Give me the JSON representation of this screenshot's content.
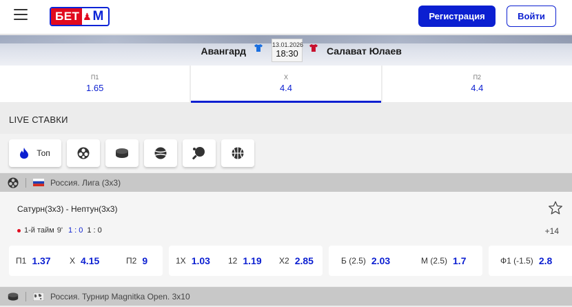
{
  "header": {
    "logo_text_bet": "БЕТ",
    "logo_text_m": "М",
    "register_label": "Регистрация",
    "login_label": "Войти"
  },
  "match": {
    "home_team": "Авангард",
    "away_team": "Салават Юлаев",
    "date": "13.01.2026",
    "time": "18:30",
    "home_shirt_color": "#1a6fe0",
    "away_shirt_color": "#c8102e"
  },
  "main_odds": [
    {
      "label": "П1",
      "value": "1.65"
    },
    {
      "label": "Х",
      "value": "4.4"
    },
    {
      "label": "П2",
      "value": "4.4"
    }
  ],
  "live": {
    "title": "LIVE СТАВКИ",
    "top_tab_label": "Топ",
    "sport_icons": [
      "fire-icon",
      "volleyball-icon",
      "hockey-puck-icon",
      "tennis-ball-icon",
      "table-tennis-icon",
      "basketball-icon"
    ]
  },
  "league1": {
    "name": "Россия. Лига (3х3)",
    "flag": "russia-flag"
  },
  "event": {
    "teams": "Сатурн(3х3) - Нептун(3х3)",
    "period": "1-й тайм",
    "minute": "9'",
    "score_main": "1 : 0",
    "score_period": "1 : 0",
    "more_bets": "+14",
    "bets": [
      {
        "label": "П1",
        "value": "1.37"
      },
      {
        "label": "Х",
        "value": "4.15"
      },
      {
        "label": "П2",
        "value": "9"
      },
      {
        "label": "1Х",
        "value": "1.03"
      },
      {
        "label": "12",
        "value": "1.19"
      },
      {
        "label": "Х2",
        "value": "2.85"
      },
      {
        "label": "Б (2.5)",
        "value": "2.03"
      },
      {
        "label": "М (2.5)",
        "value": "1.7"
      },
      {
        "label": "Ф1 (-1.5)",
        "value": "2.8"
      }
    ]
  },
  "league2": {
    "name": "Россия. Турнир Magnitka Open. 3х10",
    "flag": "generic-flag"
  },
  "colors": {
    "brand_blue": "#0b1fd1",
    "brand_red": "#e10a1e"
  }
}
